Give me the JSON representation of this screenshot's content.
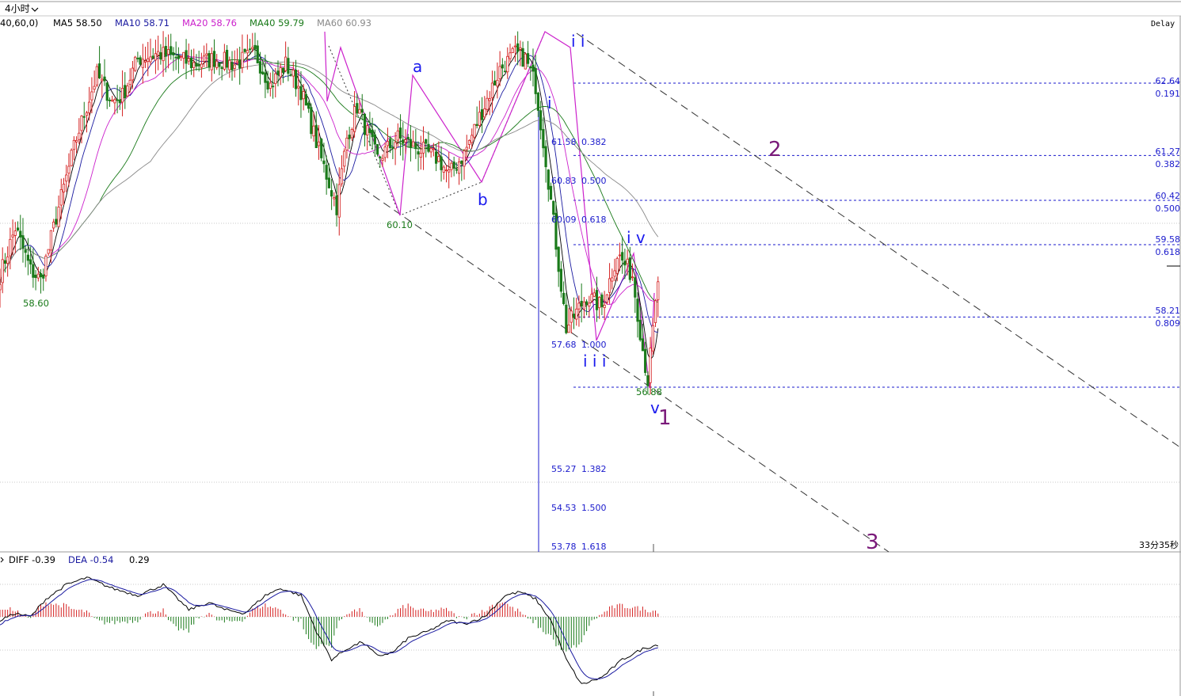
{
  "window": {
    "timeframe": "4小时",
    "delay": "Delay",
    "countdown": "33分35秒"
  },
  "ma_header": {
    "prefix": "40,60,0)",
    "items": [
      {
        "label": "MA5 58.50",
        "color": "#000000"
      },
      {
        "label": "MA10 58.71",
        "color": "#1a1aa0"
      },
      {
        "label": "MA20 58.76",
        "color": "#cc22cc"
      },
      {
        "label": "MA40 59.79",
        "color": "#1a7a1a"
      },
      {
        "label": "MA60 60.93",
        "color": "#8a8a8a"
      }
    ]
  },
  "macd_header": {
    "items": [
      {
        "label": "DIFF -0.39",
        "color": "#000000"
      },
      {
        "label": "DEA -0.54",
        "color": "#1a1aa0"
      },
      {
        "label": "0.29",
        "color": "#000000"
      }
    ]
  },
  "colors": {
    "up": "#d42020",
    "down": "#1a7a1a",
    "fib": "#1a1acc",
    "wave_blue": "#1a1aee",
    "wave_purple": "#7a1a7a",
    "grid": "#c8c8c8"
  },
  "chart_data": {
    "type": "candlestick",
    "title": "",
    "ylim": [
      53.5,
      63.4
    ],
    "price_labels": [
      {
        "text": "58.60",
        "price": 58.6,
        "color": "#1a7a1a"
      },
      {
        "text": "60.10",
        "price": 60.1,
        "color": "#1a7a1a"
      },
      {
        "text": "56.88",
        "price": 56.88,
        "color": "#1a7a1a"
      }
    ],
    "fib_right": [
      {
        "price": 62.64,
        "ratio": "0.191"
      },
      {
        "price": 61.27,
        "ratio": "0.382"
      },
      {
        "price": 60.42,
        "ratio": "0.500"
      },
      {
        "price": 59.58,
        "ratio": "0.618"
      },
      {
        "price": 58.21,
        "ratio": "0.809"
      },
      {
        "price": 56.88,
        "ratio": ""
      }
    ],
    "fib_left": [
      {
        "price": 61.58,
        "ratio": "0.382"
      },
      {
        "price": 60.83,
        "ratio": "0.500"
      },
      {
        "price": 60.09,
        "ratio": "0.618"
      },
      {
        "price": 57.68,
        "ratio": "1.000"
      },
      {
        "price": 55.27,
        "ratio": "1.382"
      },
      {
        "price": 54.53,
        "ratio": "1.500"
      },
      {
        "price": 53.78,
        "ratio": "1.618"
      }
    ],
    "wave_labels": [
      {
        "text": "a",
        "color": "blue"
      },
      {
        "text": "b",
        "color": "blue"
      },
      {
        "text": "i i",
        "color": "blue"
      },
      {
        "text": "i",
        "color": "blue"
      },
      {
        "text": "i v",
        "color": "blue"
      },
      {
        "text": "i i i",
        "color": "blue"
      },
      {
        "text": "v",
        "color": "blue"
      },
      {
        "text": "1",
        "color": "purple"
      },
      {
        "text": "2",
        "color": "purple"
      },
      {
        "text": "3",
        "color": "purple"
      }
    ],
    "anchor_closes": [
      [
        0,
        59.0
      ],
      [
        6,
        59.9
      ],
      [
        12,
        59.1
      ],
      [
        16,
        58.9
      ],
      [
        22,
        60.1
      ],
      [
        30,
        61.6
      ],
      [
        38,
        62.8
      ],
      [
        44,
        62.3
      ],
      [
        48,
        62.4
      ],
      [
        54,
        63.1
      ],
      [
        62,
        63.2
      ],
      [
        70,
        63.1
      ],
      [
        76,
        63.0
      ],
      [
        84,
        63.1
      ],
      [
        92,
        63.0
      ],
      [
        100,
        63.2
      ],
      [
        106,
        62.6
      ],
      [
        112,
        63.0
      ],
      [
        118,
        62.5
      ],
      [
        126,
        61.2
      ],
      [
        132,
        60.3
      ],
      [
        136,
        61.6
      ],
      [
        140,
        62.2
      ],
      [
        148,
        61.2
      ],
      [
        156,
        61.6
      ],
      [
        164,
        61.4
      ],
      [
        172,
        61.2
      ],
      [
        176,
        60.9
      ],
      [
        182,
        61.3
      ],
      [
        188,
        62.0
      ],
      [
        196,
        62.9
      ],
      [
        202,
        63.2
      ],
      [
        206,
        63.1
      ],
      [
        210,
        62.6
      ],
      [
        214,
        61.2
      ],
      [
        218,
        59.6
      ],
      [
        222,
        58.0
      ],
      [
        226,
        58.3
      ],
      [
        230,
        58.6
      ],
      [
        236,
        58.4
      ],
      [
        242,
        59.4
      ],
      [
        248,
        59.0
      ],
      [
        252,
        57.6
      ],
      [
        254,
        57.0
      ],
      [
        258,
        58.9
      ]
    ],
    "anchor_macd": [
      [
        0,
        -0.05
      ],
      [
        6,
        0.05
      ],
      [
        12,
        0.0
      ],
      [
        18,
        0.25
      ],
      [
        26,
        0.45
      ],
      [
        34,
        0.55
      ],
      [
        44,
        0.4
      ],
      [
        54,
        0.3
      ],
      [
        64,
        0.45
      ],
      [
        74,
        0.1
      ],
      [
        82,
        0.2
      ],
      [
        88,
        0.1
      ],
      [
        96,
        0.05
      ],
      [
        104,
        0.3
      ],
      [
        110,
        0.4
      ],
      [
        118,
        0.3
      ],
      [
        124,
        -0.2
      ],
      [
        130,
        -0.6
      ],
      [
        136,
        -0.45
      ],
      [
        142,
        -0.35
      ],
      [
        148,
        -0.55
      ],
      [
        154,
        -0.5
      ],
      [
        160,
        -0.3
      ],
      [
        168,
        -0.2
      ],
      [
        176,
        -0.05
      ],
      [
        182,
        -0.1
      ],
      [
        190,
        0.0
      ],
      [
        198,
        0.3
      ],
      [
        204,
        0.35
      ],
      [
        210,
        0.25
      ],
      [
        216,
        -0.05
      ],
      [
        222,
        -0.6
      ],
      [
        228,
        -0.95
      ],
      [
        236,
        -0.85
      ],
      [
        244,
        -0.6
      ],
      [
        252,
        -0.45
      ],
      [
        258,
        -0.39
      ]
    ]
  }
}
